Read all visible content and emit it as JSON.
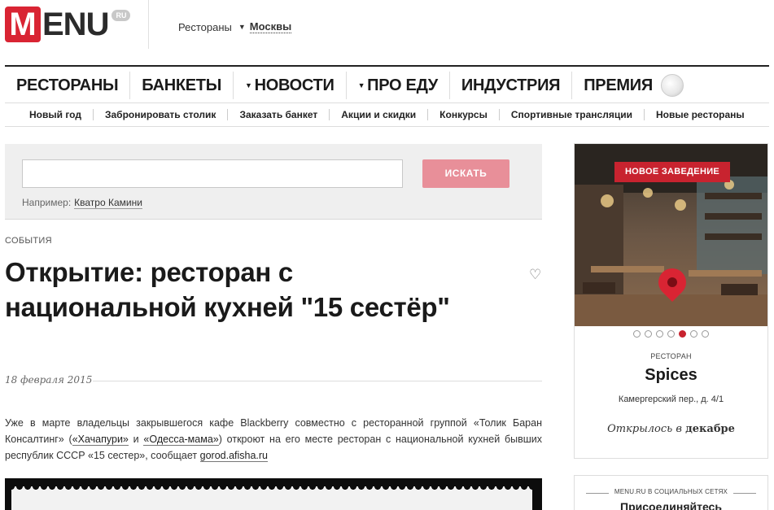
{
  "header": {
    "logo_m": "M",
    "logo_rest": "ENU",
    "logo_ru": "RU",
    "city_label": "Рестораны",
    "city_name": "Москвы"
  },
  "main_nav": [
    {
      "label": "РЕСТОРАНЫ",
      "dropdown": false
    },
    {
      "label": "БАНКЕТЫ",
      "dropdown": false
    },
    {
      "label": "НОВОСТИ",
      "dropdown": true
    },
    {
      "label": "ПРО ЕДУ",
      "dropdown": true
    },
    {
      "label": "ИНДУСТРИЯ",
      "dropdown": false
    },
    {
      "label": "ПРЕМИЯ",
      "dropdown": false
    }
  ],
  "sub_nav": [
    "Новый год",
    "Забронировать столик",
    "Заказать банкет",
    "Акции и скидки",
    "Конкурсы",
    "Спортивные трансляции",
    "Новые рестораны"
  ],
  "search": {
    "button": "ИСКАТЬ",
    "hint_label": "Например:",
    "hint_example": "Кватро Камини",
    "value": ""
  },
  "article": {
    "category": "СОБЫТИЯ",
    "title": "Открытие: ресторан с национальной кухней \"15 сестёр\"",
    "date": "18 февраля 2015",
    "text_1": "Уже в марте владельцы закрывшегося кафе Blackberry совместно с ресторанной группой «Толик Баран Консалтинг» (",
    "link_1": "«Хачапури»",
    "text_2": " и ",
    "link_2": "«Одесса-мама»",
    "text_3": ") откроют на его месте ресторан с национальной кухней бывших республик СССР «15 сестер», сообщает ",
    "link_3": "gorod.afisha.ru"
  },
  "promo": {
    "badge": "НОВОЕ ЗАВЕДЕНИЕ",
    "slides_total": 7,
    "slide_active": 5,
    "type": "РЕСТОРАН",
    "name": "Spices",
    "address": "Камергерский пер., д. 4/1",
    "opened_prefix": "Открылось в",
    "opened_month": "декабре"
  },
  "social": {
    "title": "MENU.RU В СОЦИАЛЬНЫХ СЕТЯХ",
    "join": "Присоединяйтесь"
  },
  "colors": {
    "brand_red": "#d92433",
    "search_button": "#e88f99"
  }
}
